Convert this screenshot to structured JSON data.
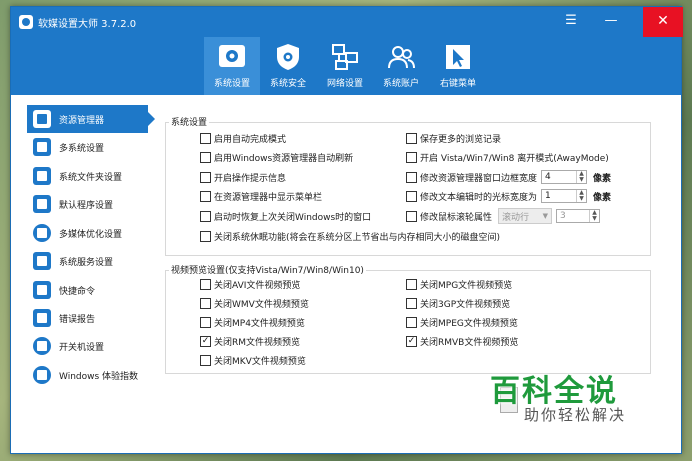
{
  "app": {
    "title": "软媒设置大师 3.7.2.0",
    "menu_glyph": "☰",
    "min_glyph": "—",
    "close_glyph": "✕"
  },
  "toolbar": {
    "tabs": [
      {
        "label": "系统设置",
        "icon": "gear-shield-icon",
        "active": true
      },
      {
        "label": "系统安全",
        "icon": "shield-icon",
        "active": false
      },
      {
        "label": "网络设置",
        "icon": "network-icon",
        "active": false
      },
      {
        "label": "系统账户",
        "icon": "users-icon",
        "active": false
      },
      {
        "label": "右键菜单",
        "icon": "cursor-icon",
        "active": false
      }
    ]
  },
  "sidebar": {
    "items": [
      {
        "label": "资源管理器",
        "icon": "monitor-icon",
        "active": true
      },
      {
        "label": "多系统设置",
        "icon": "menu-list-icon"
      },
      {
        "label": "系统文件夹设置",
        "icon": "windows-icon"
      },
      {
        "label": "默认程序设置",
        "icon": "check-icon"
      },
      {
        "label": "多媒体优化设置",
        "icon": "play-icon"
      },
      {
        "label": "系统服务设置",
        "icon": "link-icon"
      },
      {
        "label": "快捷命令",
        "icon": "arrow-box-icon"
      },
      {
        "label": "错误报告",
        "icon": "edit-icon"
      },
      {
        "label": "开关机设置",
        "icon": "power-icon"
      },
      {
        "label": "Windows 体验指数",
        "icon": "star-icon"
      }
    ]
  },
  "system_settings": {
    "title": "系统设置",
    "left": [
      {
        "label": "启用自动完成模式",
        "checked": false
      },
      {
        "label": "启用Windows资源管理器自动刷新",
        "checked": false
      },
      {
        "label": "开启操作提示信息",
        "checked": false
      },
      {
        "label": "在资源管理器中显示菜单栏",
        "checked": false
      },
      {
        "label": "启动时恢复上次关闭Windows时的窗口",
        "checked": false
      },
      {
        "label": "关闭系统休眠功能(将会在系统分区上节省出与内存相同大小的磁盘空间)",
        "checked": false
      }
    ],
    "right": [
      {
        "label": "保存更多的浏览记录",
        "checked": false
      },
      {
        "label": "开启 Vista/Win7/Win8 离开模式(AwayMode)",
        "checked": false
      },
      {
        "label": "修改资源管理器窗口边框宽度",
        "checked": false,
        "value": "4",
        "unit": "像素"
      },
      {
        "label": "修改文本编辑时的光标宽度为",
        "checked": false,
        "value": "1",
        "unit": "像素"
      },
      {
        "label": "修改鼠标滚轮属性",
        "checked": false,
        "select": "滚动行",
        "value": "3"
      }
    ]
  },
  "video_preview": {
    "title": "视频预览设置(仅支持Vista/Win7/Win8/Win10)",
    "left": [
      {
        "label": "关闭AVI文件视频预览",
        "checked": false
      },
      {
        "label": "关闭WMV文件视频预览",
        "checked": false
      },
      {
        "label": "关闭MP4文件视频预览",
        "checked": false
      },
      {
        "label": "关闭RM文件视频预览",
        "checked": true
      },
      {
        "label": "关闭MKV文件视频预览",
        "checked": false
      }
    ],
    "right": [
      {
        "label": "关闭MPG文件视频预览",
        "checked": false
      },
      {
        "label": "关闭3GP文件视频预览",
        "checked": false
      },
      {
        "label": "关闭MPEG文件视频预览",
        "checked": false
      },
      {
        "label": "关闭RMVB文件视频预览",
        "checked": true
      }
    ]
  },
  "watermark": {
    "main": "百科全说",
    "sub": "助你轻松解决"
  },
  "colors": {
    "accent": "#1e78c8",
    "close": "#e81123",
    "watermark": "#1f9a3c"
  }
}
